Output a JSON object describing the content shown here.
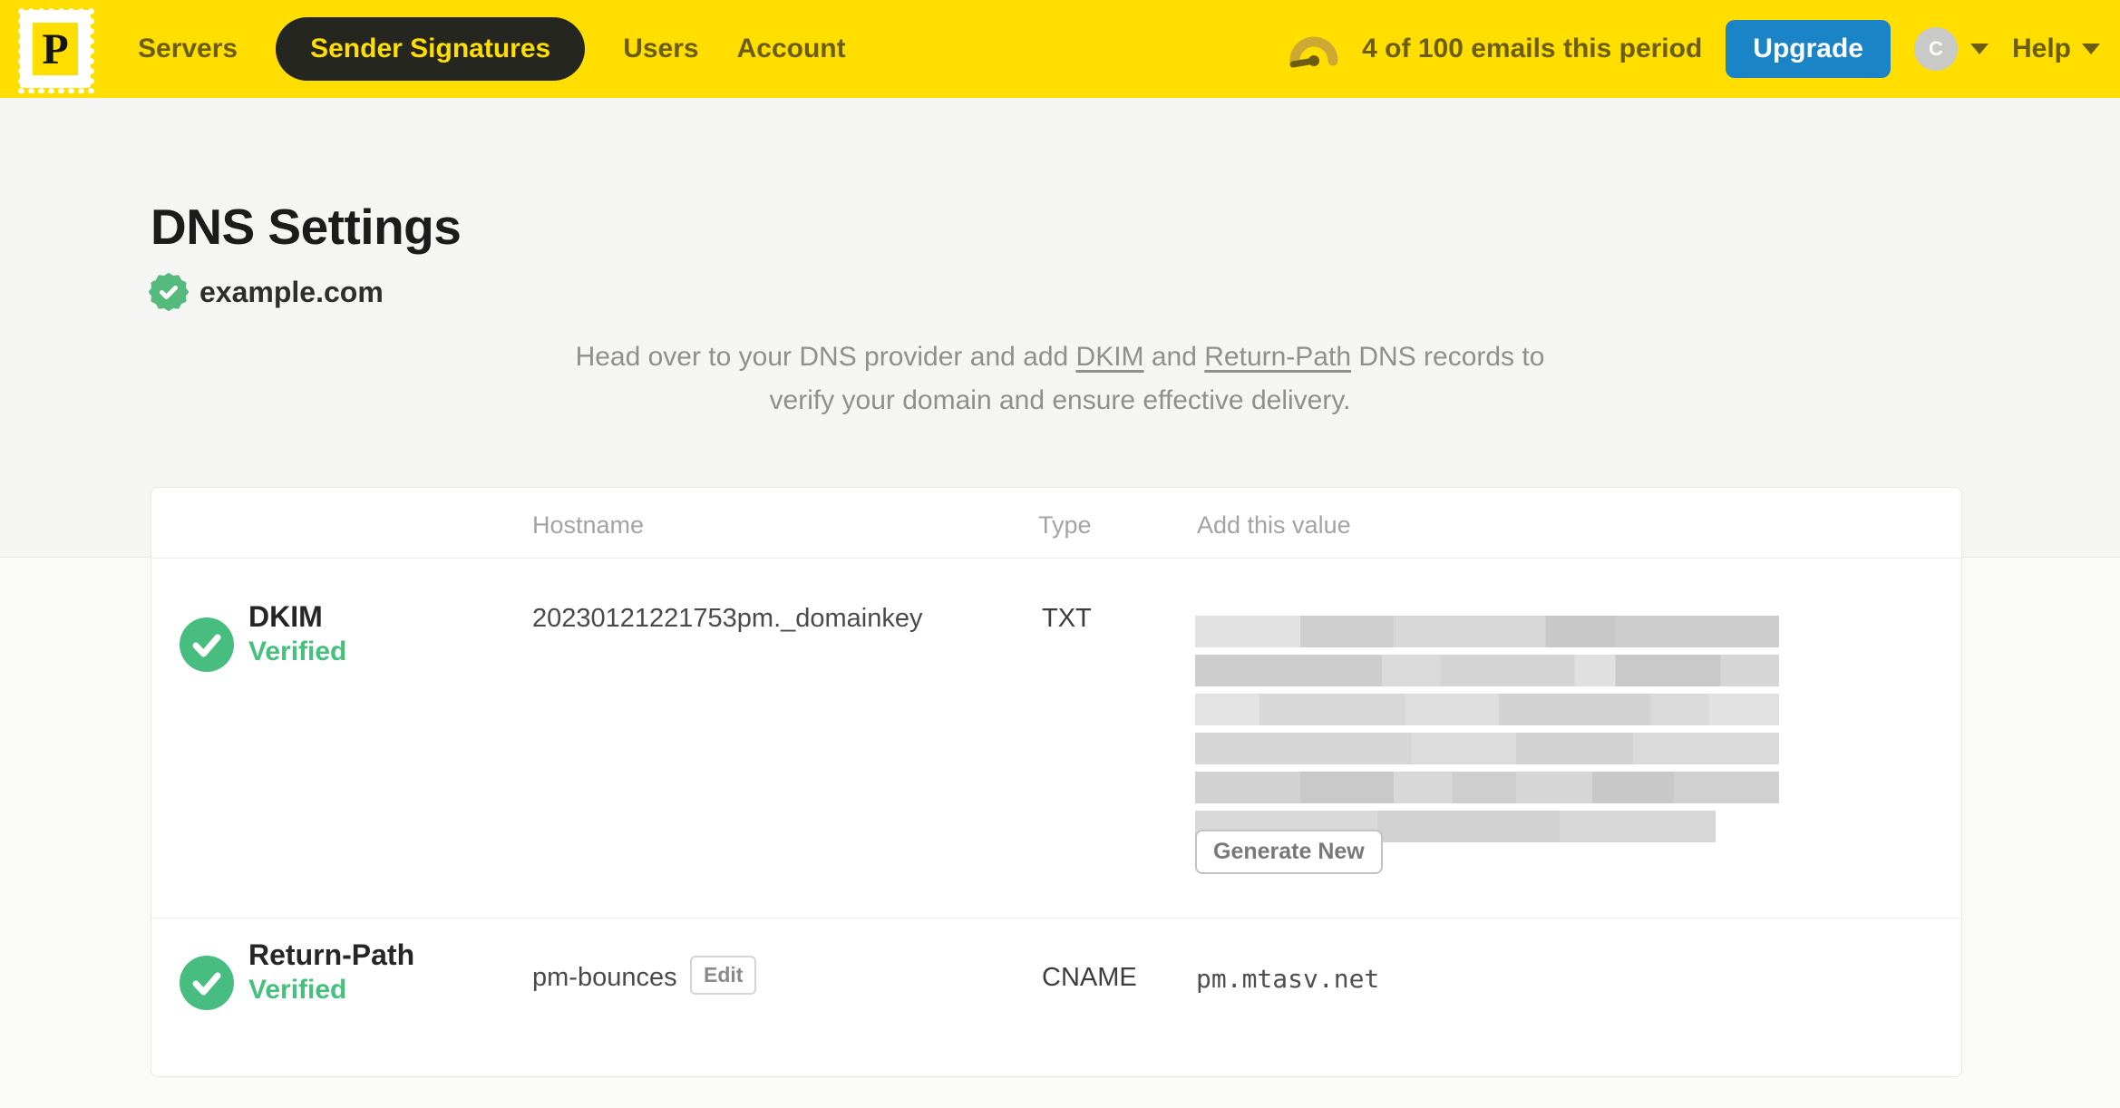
{
  "nav": {
    "logo_letter": "P",
    "items": [
      {
        "label": "Servers",
        "active": false
      },
      {
        "label": "Sender Signatures",
        "active": true
      },
      {
        "label": "Users",
        "active": false
      },
      {
        "label": "Account",
        "active": false
      }
    ],
    "usage_text": "4 of 100 emails this period",
    "upgrade_label": "Upgrade",
    "avatar_initial": "C",
    "help_label": "Help"
  },
  "page": {
    "title": "DNS Settings",
    "domain": "example.com",
    "description": {
      "text1": "Head over to your DNS provider and add ",
      "link_dkim": "DKIM",
      "text2": " and ",
      "link_return_path": "Return-Path",
      "text3": " DNS records to",
      "line2": "verify your domain and ensure effective delivery."
    }
  },
  "table": {
    "headers": {
      "hostname": "Hostname",
      "type": "Type",
      "value": "Add this value"
    },
    "rows": [
      {
        "name": "DKIM",
        "status": "Verified",
        "hostname": "20230121221753pm._domainkey",
        "type": "TXT",
        "value": "",
        "value_redacted": true,
        "action_label": "Generate New"
      },
      {
        "name": "Return-Path",
        "status": "Verified",
        "hostname": "pm-bounces",
        "hostname_action": "Edit",
        "type": "CNAME",
        "value": "pm.mtasv.net"
      }
    ]
  },
  "colors": {
    "brand_yellow": "#ffde00",
    "nav_text": "#6b5d12",
    "active_pill": "#262621",
    "upgrade_blue": "#1a84c7",
    "verified_green": "#45c17d",
    "check_circle_green": "#47bd80"
  }
}
